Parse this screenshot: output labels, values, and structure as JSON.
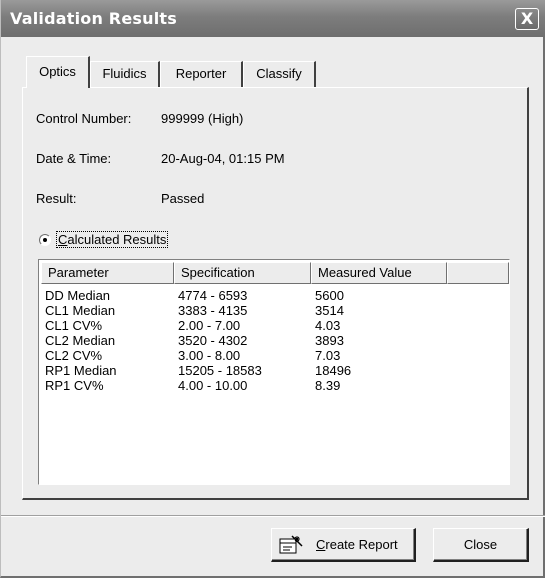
{
  "window": {
    "title": "Validation Results",
    "close_glyph": "X"
  },
  "tabs": [
    {
      "label": "Optics",
      "active": true
    },
    {
      "label": "Fluidics",
      "active": false
    },
    {
      "label": "Reporter",
      "active": false
    },
    {
      "label": "Classify",
      "active": false
    }
  ],
  "info": {
    "control_number_label": "Control Number:",
    "control_number_value": "999999 (High)",
    "datetime_label": "Date & Time:",
    "datetime_value": "20-Aug-04, 01:15 PM",
    "result_label": "Result:",
    "result_value": "Passed"
  },
  "calculated": {
    "radio_label": "Calculated Results",
    "selected": true
  },
  "table": {
    "columns": [
      "Parameter",
      "Specification",
      "Measured Value",
      ""
    ],
    "rows": [
      [
        "DD Median",
        "4774 - 6593",
        "5600"
      ],
      [
        "CL1 Median",
        "3383 - 4135",
        "3514"
      ],
      [
        "CL1 CV%",
        "2.00 - 7.00",
        "4.03"
      ],
      [
        "CL2 Median",
        "3520 - 4302",
        "3893"
      ],
      [
        "CL2 CV%",
        "3.00 - 8.00",
        "7.03"
      ],
      [
        "RP1 Median",
        "15205 - 18583",
        "18496"
      ],
      [
        "RP1 CV%",
        "4.00 - 10.00",
        "8.39"
      ]
    ]
  },
  "buttons": {
    "create_report_accel": "C",
    "create_report_rest": "reate Report",
    "create_report_icon": "report-wizard-icon",
    "close_label": "Close"
  }
}
